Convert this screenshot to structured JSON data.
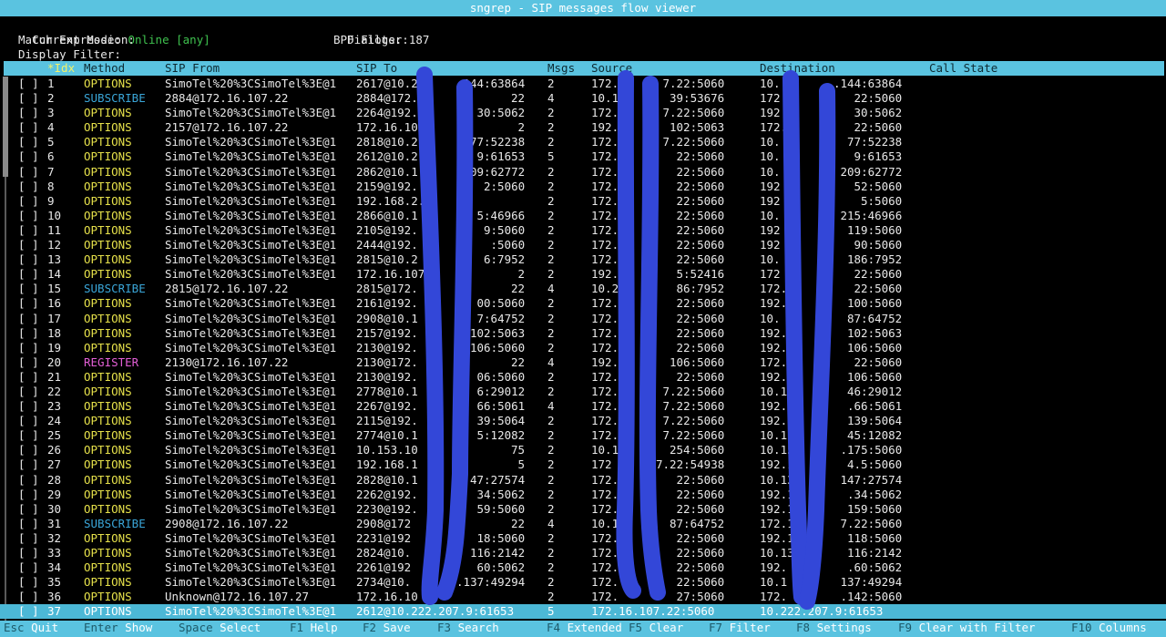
{
  "title": "sngrep - SIP messages flow viewer",
  "header": {
    "mode_label": "Current Mode:",
    "mode_value": "Online [any]",
    "dialogs_label": "Dialogs:",
    "dialogs_value": "187",
    "match_label": "Match Expression:",
    "bpf_label": "BPF Filter:",
    "display_label": "Display Filter:"
  },
  "columns": {
    "idx": "*Idx",
    "method": "Method",
    "from": "SIP From",
    "to": "SIP To",
    "msgs": "Msgs",
    "source": "Source",
    "destination": "Destination",
    "state": "Call State"
  },
  "checkbox": "[ ]",
  "rows": [
    {
      "idx": "1",
      "method": "OPTIONS",
      "from": "SimoTel%20%3CSimoTel%3E@1",
      "to": "2617@10.2",
      "to_tail": "144:63864",
      "msgs": "2",
      "source": "172.",
      "source_tail": "7.22:5060",
      "dest": "10.",
      "dest_tail": ".144:63864"
    },
    {
      "idx": "2",
      "method": "SUBSCRIBE",
      "from": "2884@172.16.107.22",
      "to": "2884@172.",
      "to_tail": "22",
      "msgs": "4",
      "source": "10.1",
      "source_tail": "39:53676",
      "dest": "172.",
      "dest_tail": "22:5060"
    },
    {
      "idx": "3",
      "method": "OPTIONS",
      "from": "SimoTel%20%3CSimoTel%3E@1",
      "to": "2264@192.",
      "to_tail": "30:5062",
      "msgs": "2",
      "source": "172.",
      "source_tail": "7.22:5060",
      "dest": "192.",
      "dest_tail": "30:5062"
    },
    {
      "idx": "4",
      "method": "OPTIONS",
      "from": "2157@172.16.107.22",
      "to": "172.16.10",
      "to_tail": "2",
      "msgs": "2",
      "source": "192.",
      "source_tail": "102:5063",
      "dest": "172.",
      "dest_tail": "22:5060"
    },
    {
      "idx": "5",
      "method": "OPTIONS",
      "from": "SimoTel%20%3CSimoTel%3E@1",
      "to": "2818@10.2",
      "to_tail": "77:52238",
      "msgs": "2",
      "source": "172.",
      "source_tail": "7.22:5060",
      "dest": "10.",
      "dest_tail": "77:52238"
    },
    {
      "idx": "6",
      "method": "OPTIONS",
      "from": "SimoTel%20%3CSimoTel%3E@1",
      "to": "2612@10.2",
      "to_tail": "9:61653",
      "msgs": "5",
      "source": "172.",
      "source_tail": "22:5060",
      "dest": "10.",
      "dest_tail": "9:61653"
    },
    {
      "idx": "7",
      "method": "OPTIONS",
      "from": "SimoTel%20%3CSimoTel%3E@1",
      "to": "2862@10.1",
      "to_tail": "09:62772",
      "msgs": "2",
      "source": "172.",
      "source_tail": "22:5060",
      "dest": "10.",
      "dest_tail": "209:62772"
    },
    {
      "idx": "8",
      "method": "OPTIONS",
      "from": "SimoTel%20%3CSimoTel%3E@1",
      "to": "2159@192.",
      "to_tail": "2:5060",
      "msgs": "2",
      "source": "172.",
      "source_tail": "22:5060",
      "dest": "192",
      "dest_tail": "52:5060"
    },
    {
      "idx": "9",
      "method": "OPTIONS",
      "from": "SimoTel%20%3CSimoTel%3E@1",
      "to": "192.168.2.",
      "to_tail": "",
      "msgs": "2",
      "source": "172.",
      "source_tail": "22:5060",
      "dest": "192",
      "dest_tail": "5:5060"
    },
    {
      "idx": "10",
      "method": "OPTIONS",
      "from": "SimoTel%20%3CSimoTel%3E@1",
      "to": "2866@10.1",
      "to_tail": "5:46966",
      "msgs": "2",
      "source": "172.",
      "source_tail": "22:5060",
      "dest": "10.",
      "dest_tail": "215:46966"
    },
    {
      "idx": "11",
      "method": "OPTIONS",
      "from": "SimoTel%20%3CSimoTel%3E@1",
      "to": "2105@192.",
      "to_tail": "9:5060",
      "msgs": "2",
      "source": "172.",
      "source_tail": "22:5060",
      "dest": "192",
      "dest_tail": "119:5060"
    },
    {
      "idx": "12",
      "method": "OPTIONS",
      "from": "SimoTel%20%3CSimoTel%3E@1",
      "to": "2444@192.",
      "to_tail": ":5060",
      "msgs": "2",
      "source": "172.",
      "source_tail": "22:5060",
      "dest": "192",
      "dest_tail": "90:5060"
    },
    {
      "idx": "13",
      "method": "OPTIONS",
      "from": "SimoTel%20%3CSimoTel%3E@1",
      "to": "2815@10.2",
      "to_tail": "6:7952",
      "msgs": "2",
      "source": "172.",
      "source_tail": "22:5060",
      "dest": "10.",
      "dest_tail": "186:7952"
    },
    {
      "idx": "14",
      "method": "OPTIONS",
      "from": "SimoTel%20%3CSimoTel%3E@1",
      "to": "172.16.107",
      "to_tail": "2",
      "msgs": "2",
      "source": "192.",
      "source_tail": "5:52416",
      "dest": "172",
      "dest_tail": "22:5060"
    },
    {
      "idx": "15",
      "method": "SUBSCRIBE",
      "from": "2815@172.16.107.22",
      "to": "2815@172.",
      "to_tail": "22",
      "msgs": "4",
      "source": "10.2",
      "source_tail": "86:7952",
      "dest": "172.",
      "dest_tail": "22:5060"
    },
    {
      "idx": "16",
      "method": "OPTIONS",
      "from": "SimoTel%20%3CSimoTel%3E@1",
      "to": "2161@192.",
      "to_tail": "00:5060",
      "msgs": "2",
      "source": "172.",
      "source_tail": "22:5060",
      "dest": "192.",
      "dest_tail": "100:5060"
    },
    {
      "idx": "17",
      "method": "OPTIONS",
      "from": "SimoTel%20%3CSimoTel%3E@1",
      "to": "2908@10.1",
      "to_tail": "7:64752",
      "msgs": "2",
      "source": "172.",
      "source_tail": "22:5060",
      "dest": "10.",
      "dest_tail": "87:64752"
    },
    {
      "idx": "18",
      "method": "OPTIONS",
      "from": "SimoTel%20%3CSimoTel%3E@1",
      "to": "2157@192.",
      "to_tail": "102:5063",
      "msgs": "2",
      "source": "172.",
      "source_tail": "22:5060",
      "dest": "192.",
      "dest_tail": "102:5063"
    },
    {
      "idx": "19",
      "method": "OPTIONS",
      "from": "SimoTel%20%3CSimoTel%3E@1",
      "to": "2130@192.",
      "to_tail": "106:5060",
      "msgs": "2",
      "source": "172.",
      "source_tail": "22:5060",
      "dest": "192.",
      "dest_tail": "106:5060"
    },
    {
      "idx": "20",
      "method": "REGISTER",
      "from": "2130@172.16.107.22",
      "to": "2130@172.",
      "to_tail": "22",
      "msgs": "4",
      "source": "192.",
      "source_tail": "106:5060",
      "dest": "172.",
      "dest_tail": "22:5060"
    },
    {
      "idx": "21",
      "method": "OPTIONS",
      "from": "SimoTel%20%3CSimoTel%3E@1",
      "to": "2130@192.",
      "to_tail": "06:5060",
      "msgs": "2",
      "source": "172.",
      "source_tail": "22:5060",
      "dest": "192.",
      "dest_tail": "106:5060"
    },
    {
      "idx": "22",
      "method": "OPTIONS",
      "from": "SimoTel%20%3CSimoTel%3E@1",
      "to": "2778@10.1",
      "to_tail": "6:29012",
      "msgs": "2",
      "source": "172.",
      "source_tail": "7.22:5060",
      "dest": "10.1",
      "dest_tail": "46:29012"
    },
    {
      "idx": "23",
      "method": "OPTIONS",
      "from": "SimoTel%20%3CSimoTel%3E@1",
      "to": "2267@192.",
      "to_tail": "66:5061",
      "msgs": "4",
      "source": "172.",
      "source_tail": "7.22:5060",
      "dest": "192.",
      "dest_tail": ".66:5061"
    },
    {
      "idx": "24",
      "method": "OPTIONS",
      "from": "SimoTel%20%3CSimoTel%3E@1",
      "to": "2115@192.",
      "to_tail": "39:5064",
      "msgs": "2",
      "source": "172.",
      "source_tail": "7.22:5060",
      "dest": "192.",
      "dest_tail": "139:5064"
    },
    {
      "idx": "25",
      "method": "OPTIONS",
      "from": "SimoTel%20%3CSimoTel%3E@1",
      "to": "2774@10.1",
      "to_tail": "5:12082",
      "msgs": "2",
      "source": "172.",
      "source_tail": "7.22:5060",
      "dest": "10.1",
      "dest_tail": "45:12082"
    },
    {
      "idx": "26",
      "method": "OPTIONS",
      "from": "SimoTel%20%3CSimoTel%3E@1",
      "to": "10.153.10",
      "to_tail": "75",
      "msgs": "2",
      "source": "10.1",
      "source_tail": "254:5060",
      "dest": "10.15",
      "dest_tail": ".175:5060"
    },
    {
      "idx": "27",
      "method": "OPTIONS",
      "from": "SimoTel%20%3CSimoTel%3E@1",
      "to": "192.168.1",
      "to_tail": "5",
      "msgs": "2",
      "source": "172",
      "source_tail": "7.22:54938",
      "dest": "192.1",
      "dest_tail": "4.5:5060"
    },
    {
      "idx": "28",
      "method": "OPTIONS",
      "from": "SimoTel%20%3CSimoTel%3E@1",
      "to": "2828@10.1",
      "to_tail": "47:27574",
      "msgs": "2",
      "source": "172.",
      "source_tail": "22:5060",
      "dest": "10.13",
      "dest_tail": "147:27574"
    },
    {
      "idx": "29",
      "method": "OPTIONS",
      "from": "SimoTel%20%3CSimoTel%3E@1",
      "to": "2262@192.",
      "to_tail": "34:5062",
      "msgs": "2",
      "source": "172.",
      "source_tail": "22:5060",
      "dest": "192.1",
      "dest_tail": ".34:5062"
    },
    {
      "idx": "30",
      "method": "OPTIONS",
      "from": "SimoTel%20%3CSimoTel%3E@1",
      "to": "2230@192.",
      "to_tail": "59:5060",
      "msgs": "2",
      "source": "172.",
      "source_tail": "22:5060",
      "dest": "192.1",
      "dest_tail": "159:5060"
    },
    {
      "idx": "31",
      "method": "SUBSCRIBE",
      "from": "2908@172.16.107.22",
      "to": "2908@172",
      "to_tail": "22",
      "msgs": "4",
      "source": "10.1",
      "source_tail": "87:64752",
      "dest": "172.1",
      "dest_tail": "7.22:5060"
    },
    {
      "idx": "32",
      "method": "OPTIONS",
      "from": "SimoTel%20%3CSimoTel%3E@1",
      "to": "2231@192",
      "to_tail": "18:5060",
      "msgs": "2",
      "source": "172.",
      "source_tail": "22:5060",
      "dest": "192.1",
      "dest_tail": "118:5060"
    },
    {
      "idx": "33",
      "method": "OPTIONS",
      "from": "SimoTel%20%3CSimoTel%3E@1",
      "to": "2824@10.",
      "to_tail": "116:2142",
      "msgs": "2",
      "source": "172.",
      "source_tail": "22:5060",
      "dest": "10.13",
      "dest_tail": "116:2142"
    },
    {
      "idx": "34",
      "method": "OPTIONS",
      "from": "SimoTel%20%3CSimoTel%3E@1",
      "to": "2261@192",
      "to_tail": "60:5062",
      "msgs": "2",
      "source": "172.",
      "source_tail": "22:5060",
      "dest": "192.",
      "dest_tail": ".60:5062"
    },
    {
      "idx": "35",
      "method": "OPTIONS",
      "from": "SimoTel%20%3CSimoTel%3E@1",
      "to": "2734@10.",
      "to_tail": "3.137:49294",
      "msgs": "2",
      "source": "172.",
      "source_tail": "22:5060",
      "dest": "10.1",
      "dest_tail": "137:49294"
    },
    {
      "idx": "36",
      "method": "OPTIONS",
      "from": "Unknown@172.16.107.27",
      "to": "172.16.10",
      "to_tail": "",
      "msgs": "2",
      "source": "172.",
      "source_tail": "27:5060",
      "dest": "172.",
      "dest_tail": ".142:5060"
    },
    {
      "idx": "37",
      "method": "OPTIONS",
      "from": "SimoTel%20%3CSimoTel%3E@1",
      "to": "2612@10.222.207.9:61653",
      "to_tail": "",
      "msgs": "5",
      "source": "172.16.107.22:5060",
      "source_tail": "",
      "dest": "10.222.207.9:61653",
      "dest_tail": "",
      "selected": true
    }
  ],
  "footer": [
    {
      "key": "Esc",
      "action": "Quit"
    },
    {
      "key": "Enter",
      "action": "Show"
    },
    {
      "key": "Space",
      "action": "Select"
    },
    {
      "key": "F1",
      "action": "Help"
    },
    {
      "key": "F2",
      "action": "Save"
    },
    {
      "key": "F3",
      "action": "Search"
    },
    {
      "key": "F4",
      "action": "Extended"
    },
    {
      "key": "F5",
      "action": "Clear"
    },
    {
      "key": "F7",
      "action": "Filter"
    },
    {
      "key": "F8",
      "action": "Settings"
    },
    {
      "key": "F9",
      "action": "Clear with Filter"
    },
    {
      "key": "F10",
      "action": "Columns"
    }
  ],
  "colors": {
    "accent": "#5ac3e0",
    "options": "#e5e04a",
    "subscribe": "#3aa6d8",
    "register": "#e35fd6",
    "scribble": "#3347d8"
  }
}
